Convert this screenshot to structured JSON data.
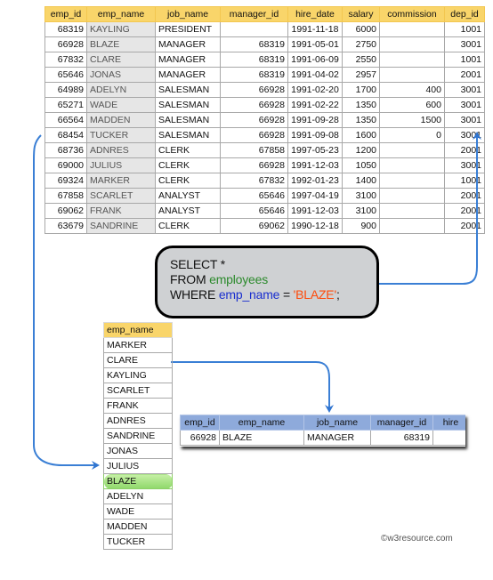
{
  "employees_table": {
    "columns": [
      "emp_id",
      "emp_name",
      "job_name",
      "manager_id",
      "hire_date",
      "salary",
      "commission",
      "dep_id"
    ],
    "rows": [
      [
        "68319",
        "KAYLING",
        "PRESIDENT",
        "",
        "1991-11-18",
        "6000",
        "",
        "1001"
      ],
      [
        "66928",
        "BLAZE",
        "MANAGER",
        "68319",
        "1991-05-01",
        "2750",
        "",
        "3001"
      ],
      [
        "67832",
        "CLARE",
        "MANAGER",
        "68319",
        "1991-06-09",
        "2550",
        "",
        "1001"
      ],
      [
        "65646",
        "JONAS",
        "MANAGER",
        "68319",
        "1991-04-02",
        "2957",
        "",
        "2001"
      ],
      [
        "64989",
        "ADELYN",
        "SALESMAN",
        "66928",
        "1991-02-20",
        "1700",
        "400",
        "3001"
      ],
      [
        "65271",
        "WADE",
        "SALESMAN",
        "66928",
        "1991-02-22",
        "1350",
        "600",
        "3001"
      ],
      [
        "66564",
        "MADDEN",
        "SALESMAN",
        "66928",
        "1991-09-28",
        "1350",
        "1500",
        "3001"
      ],
      [
        "68454",
        "TUCKER",
        "SALESMAN",
        "66928",
        "1991-09-08",
        "1600",
        "0",
        "3001"
      ],
      [
        "68736",
        "ADNRES",
        "CLERK",
        "67858",
        "1997-05-23",
        "1200",
        "",
        "2001"
      ],
      [
        "69000",
        "JULIUS",
        "CLERK",
        "66928",
        "1991-12-03",
        "1050",
        "",
        "3001"
      ],
      [
        "69324",
        "MARKER",
        "CLERK",
        "67832",
        "1992-01-23",
        "1400",
        "",
        "1001"
      ],
      [
        "67858",
        "SCARLET",
        "ANALYST",
        "65646",
        "1997-04-19",
        "3100",
        "",
        "2001"
      ],
      [
        "69062",
        "FRANK",
        "ANALYST",
        "65646",
        "1991-12-03",
        "3100",
        "",
        "2001"
      ],
      [
        "63679",
        "SANDRINE",
        "CLERK",
        "69062",
        "1990-12-18",
        "900",
        "",
        "2001"
      ]
    ]
  },
  "sql": {
    "line1": "SELECT *",
    "from_kw": "FROM ",
    "table": "employees",
    "where_kw": "WHERE ",
    "column": "emp_name",
    "operator": " = ",
    "value": "'BLAZE'",
    "terminator": ";"
  },
  "name_list": {
    "header": "emp_name",
    "items": [
      "MARKER",
      "CLARE",
      "KAYLING",
      "SCARLET",
      "FRANK",
      "ADNRES",
      "SANDRINE",
      "JONAS",
      "JULIUS",
      "BLAZE",
      "ADELYN",
      "WADE",
      "MADDEN",
      "TUCKER"
    ],
    "highlighted": "BLAZE"
  },
  "result_table": {
    "columns": [
      "emp_id",
      "emp_name",
      "job_name",
      "manager_id",
      "hire"
    ],
    "rows": [
      [
        "66928",
        "BLAZE",
        "MANAGER",
        "68319",
        ""
      ]
    ]
  },
  "credit": "©w3resource.com",
  "colors": {
    "header_yellow": "#f9d56a",
    "result_header_blue": "#8eaadb",
    "arrow_blue": "#3a7fd5",
    "highlight_green": "#9ddc7a",
    "sql_table_green": "#2c8a2c",
    "sql_column_blue": "#1a2fcf",
    "sql_value_orange": "#ff4a0a"
  }
}
